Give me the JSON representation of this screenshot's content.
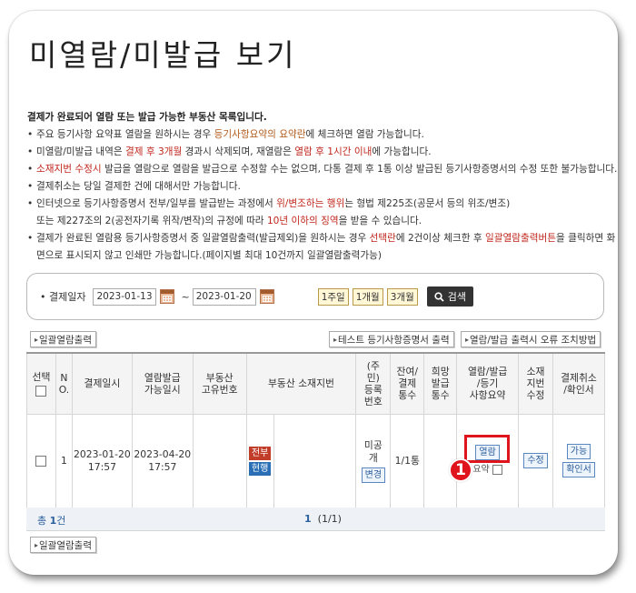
{
  "page": {
    "title": "미열람/미발급 보기"
  },
  "notes": {
    "heading": "결제가 완료되어 열람 또는 발급 가능한 부동산 목록입니다.",
    "items": [
      {
        "parts": [
          {
            "t": "주요 등기사항 요약표 열람을 원하시는 경우 "
          },
          {
            "t": "등기사항요약의 요약란",
            "c": "hl-b"
          },
          {
            "t": "에 체크하면 열람 가능합니다."
          }
        ]
      },
      {
        "parts": [
          {
            "t": "미열람/미발급 내역은 "
          },
          {
            "t": "결제 후 3개월",
            "c": "hl-r"
          },
          {
            "t": " 경과시 삭제되며, 재열람은 "
          },
          {
            "t": "열람 후 1시간 이내",
            "c": "hl-r"
          },
          {
            "t": "에 가능합니다."
          }
        ]
      },
      {
        "parts": [
          {
            "t": "소재지번 수정시",
            "c": "hl-r"
          },
          {
            "t": " 발급을 열람으로 열람을 발급으로 수정할 수는 없으며, 다통 결제 후 1통 이상 발급된 등기사항증명서의 수정 또한 불가능합니다."
          }
        ]
      },
      {
        "parts": [
          {
            "t": "결제취소는 당일 결제한 건에 대해서만 가능합니다."
          }
        ]
      },
      {
        "parts": [
          {
            "t": "인터넷으로 등기사항증명서 전부/일부를 발급받는 과정에서 "
          },
          {
            "t": "위/변조하는 행위",
            "c": "hl-r"
          },
          {
            "t": "는 형법 제225조(공문서 등의 위조/변조)"
          }
        ],
        "cont": "또는 제227조의 2(공전자기록 위작/변작)의 규정에 따라 10년 이하의 징역을 받을 수 있습니다.",
        "cont_parts": [
          {
            "t": "또는 제227조의 2(공전자기록 위작/변작)의 규정에 따라 "
          },
          {
            "t": "10년 이하의 징역",
            "c": "hl-r"
          },
          {
            "t": "을 받을 수 있습니다."
          }
        ]
      },
      {
        "parts": [
          {
            "t": "결제가 완료된 열람용 등기사항증명서 중 일괄열람출력(발급제외)을 원하시는 경우 "
          },
          {
            "t": "선택란",
            "c": "hl-r"
          },
          {
            "t": "에 2건이상 체크한 후 "
          },
          {
            "t": "일괄열람출력버튼",
            "c": "hl-r"
          },
          {
            "t": "을 클릭하면 화면으로 표시되지 않고 인쇄만 가능합니다.(페이지별 최대 10건까지 일괄열람출력가능)"
          }
        ]
      }
    ]
  },
  "filter": {
    "label": "결제일자",
    "from": "2023-01-13",
    "tilde": "~",
    "to": "2023-01-20",
    "periods": [
      "1주일",
      "1개월",
      "3개월"
    ],
    "search_label": "검색"
  },
  "toolbar": {
    "bulk_print": "일괄열람출력",
    "test_print": "테스트 등기사항증명서 출력",
    "error_help": "열람/발급 출력시 오류 조치방법"
  },
  "table": {
    "headers": {
      "select": "선택",
      "no": "N\nO.",
      "pay_date": "결제일시",
      "avail_date": "열람발급\n가능일시",
      "unique_no": "부동산\n고유번호",
      "address": "부동산 소재지번",
      "reg_no": "(주\n민)\n등록\n번호",
      "remain": "잔여/\n결제\n통수",
      "hope": "희망\n발급\n통수",
      "view_issue": "열람/발급\n/등기\n사항요약",
      "edit_addr": "소재\n지번\n수정",
      "cancel": "결제취소\n/확인서"
    },
    "rows": [
      {
        "no": "1",
        "pay_date": "2023-01-20",
        "pay_time": "17:57",
        "avail_date": "2023-04-20",
        "avail_time": "17:57",
        "tag_all": "전부",
        "tag_current": "현행",
        "reg_status": "미공\n개",
        "reg_change": "변경",
        "remain": "1/1통",
        "view_label": "열람",
        "summary_label": "요약",
        "edit_label": "수정",
        "cancel_label": "가능",
        "confirm_label": "확인서"
      }
    ],
    "total_prefix": "총",
    "total_count": "1",
    "total_suffix": "건",
    "page_current": "1",
    "page_info": "(1/1)"
  },
  "annotation": {
    "marker": "1"
  },
  "colors": {
    "accent_red": "#e0141c",
    "link_blue": "#2b5e9c",
    "highlight_brown": "#b25a1a"
  }
}
